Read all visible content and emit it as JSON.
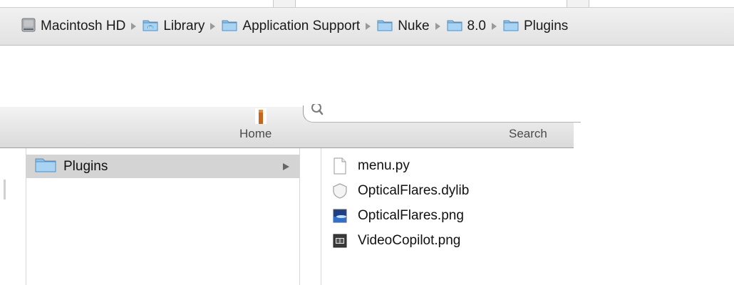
{
  "path_bar": {
    "items": [
      {
        "label": "Macintosh HD",
        "icon": "hard-drive-icon"
      },
      {
        "label": "Library",
        "icon": "library-folder-icon"
      },
      {
        "label": "Application Support",
        "icon": "folder-icon"
      },
      {
        "label": "Nuke",
        "icon": "folder-icon"
      },
      {
        "label": "8.0",
        "icon": "folder-icon"
      },
      {
        "label": "Plugins",
        "icon": "folder-icon"
      }
    ]
  },
  "toolbar": {
    "home_label": "Home",
    "search_label": "Search"
  },
  "browser": {
    "selected_folder": {
      "label": "Plugins",
      "icon": "folder-icon"
    },
    "files": [
      {
        "label": "menu.py",
        "icon": "document-icon"
      },
      {
        "label": "OpticalFlares.dylib",
        "icon": "dylib-icon"
      },
      {
        "label": "OpticalFlares.png",
        "icon": "image-icon"
      },
      {
        "label": "VideoCopilot.png",
        "icon": "image-icon"
      }
    ]
  },
  "colors": {
    "folder_blue": "#8ec3ea",
    "selection_gray": "#d4d4d4",
    "bar_gray": "#e6e6e6"
  }
}
